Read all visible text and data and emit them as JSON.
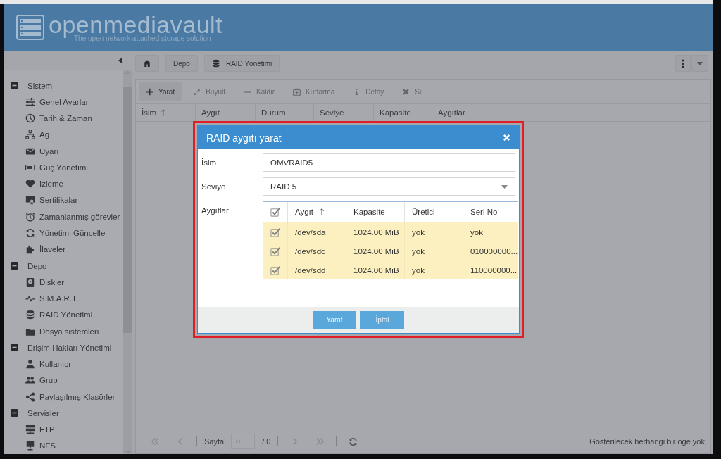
{
  "header": {
    "brand": "openmediavault",
    "tagline": "The open network attached storage solution"
  },
  "breadcrumb": [
    {
      "label": "Depo"
    },
    {
      "label": "RAID Yönetimi"
    }
  ],
  "sidebar": {
    "groups": [
      {
        "label": "Sistem",
        "expanded": true,
        "children": [
          {
            "label": "Genel Ayarlar"
          },
          {
            "label": "Tarih & Zaman"
          },
          {
            "label": "Ağ"
          },
          {
            "label": "Uyarı"
          },
          {
            "label": "Güç Yönetimi"
          },
          {
            "label": "İzleme"
          },
          {
            "label": "Sertifikalar"
          },
          {
            "label": "Zamanlanmış görevler"
          },
          {
            "label": "Yönetimi Güncelle"
          },
          {
            "label": "İlaveler"
          }
        ]
      },
      {
        "label": "Depo",
        "expanded": true,
        "children": [
          {
            "label": "Diskler"
          },
          {
            "label": "S.M.A.R.T."
          },
          {
            "label": "RAID Yönetimi"
          },
          {
            "label": "Dosya sistemleri"
          }
        ]
      },
      {
        "label": "Erişim Hakları Yönetimi",
        "expanded": true,
        "children": [
          {
            "label": "Kullanıcı"
          },
          {
            "label": "Grup"
          },
          {
            "label": "Paylaşılmış Klasörler"
          }
        ]
      },
      {
        "label": "Servisler",
        "expanded": true,
        "children": [
          {
            "label": "FTP"
          },
          {
            "label": "NFS"
          }
        ]
      }
    ]
  },
  "toolbar": {
    "buttons": [
      {
        "label": "Yarat",
        "disabled": false
      },
      {
        "label": "Büyült",
        "disabled": true
      },
      {
        "label": "Kaldır",
        "disabled": true
      },
      {
        "label": "Kurtarma",
        "disabled": true
      },
      {
        "label": "Detay",
        "disabled": true
      },
      {
        "label": "Sil",
        "disabled": true
      }
    ]
  },
  "table": {
    "columns": [
      {
        "label": "İsim",
        "sorted": true
      },
      {
        "label": "Aygıt",
        "sorted": false
      },
      {
        "label": "Durum",
        "sorted": false
      },
      {
        "label": "Seviye",
        "sorted": false
      },
      {
        "label": "Kapasite",
        "sorted": false
      },
      {
        "label": "Aygıtlar",
        "sorted": false
      }
    ]
  },
  "pager": {
    "page_label": "Sayfa",
    "page": "0",
    "total": "/ 0",
    "status": "Gösterilecek herhangi bir öge yok"
  },
  "dialog": {
    "title": "RAID aygıtı yarat",
    "fields": [
      {
        "kind": "text",
        "label": "İsim",
        "value": "OMVRAID5"
      },
      {
        "kind": "select",
        "label": "Seviye",
        "value": "RAID 5"
      },
      {
        "kind": "grid",
        "label": "Aygıtlar",
        "all_checked": true,
        "columns": [
          {
            "label": "Aygıt",
            "sorted": true
          },
          {
            "label": "Kapasite",
            "sorted": false
          },
          {
            "label": "Üretici",
            "sorted": false
          },
          {
            "label": "Seri No",
            "sorted": false
          }
        ],
        "rows": [
          {
            "cells": [
              "/dev/sda",
              "1024.00 MiB",
              "yok",
              "yok"
            ],
            "checked": true,
            "selected": true
          },
          {
            "cells": [
              "/dev/sdc",
              "1024.00 MiB",
              "yok",
              "010000000..."
            ],
            "checked": true,
            "selected": true
          },
          {
            "cells": [
              "/dev/sdd",
              "1024.00 MiB",
              "yok",
              "110000000..."
            ],
            "checked": true,
            "selected": true
          }
        ]
      }
    ],
    "buttons": [
      {
        "label": "Yarat"
      },
      {
        "label": "İptal"
      }
    ]
  }
}
